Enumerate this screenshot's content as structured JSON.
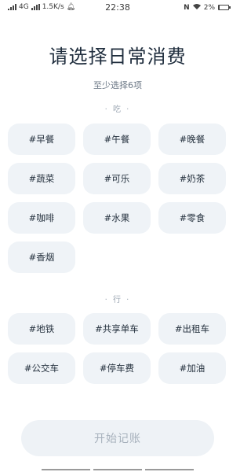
{
  "status_bar": {
    "network": "4G",
    "speed": "1.5K/s",
    "time": "22:38",
    "nfc": "N",
    "battery": "2%",
    "battery_level": 0.02
  },
  "page": {
    "title": "请选择日常消费",
    "subtitle": "至少选择6项"
  },
  "sections": [
    {
      "label": "· 吃 ·",
      "items": [
        "#早餐",
        "#午餐",
        "#晚餐",
        "#蔬菜",
        "#可乐",
        "#奶茶",
        "#咖啡",
        "#水果",
        "#零食",
        "#香烟"
      ]
    },
    {
      "label": "· 行 ·",
      "items": [
        "#地铁",
        "#共享单车",
        "#出租车",
        "#公交车",
        "#停车费",
        "#加油"
      ]
    }
  ],
  "start_button": {
    "label": "开始记账"
  }
}
